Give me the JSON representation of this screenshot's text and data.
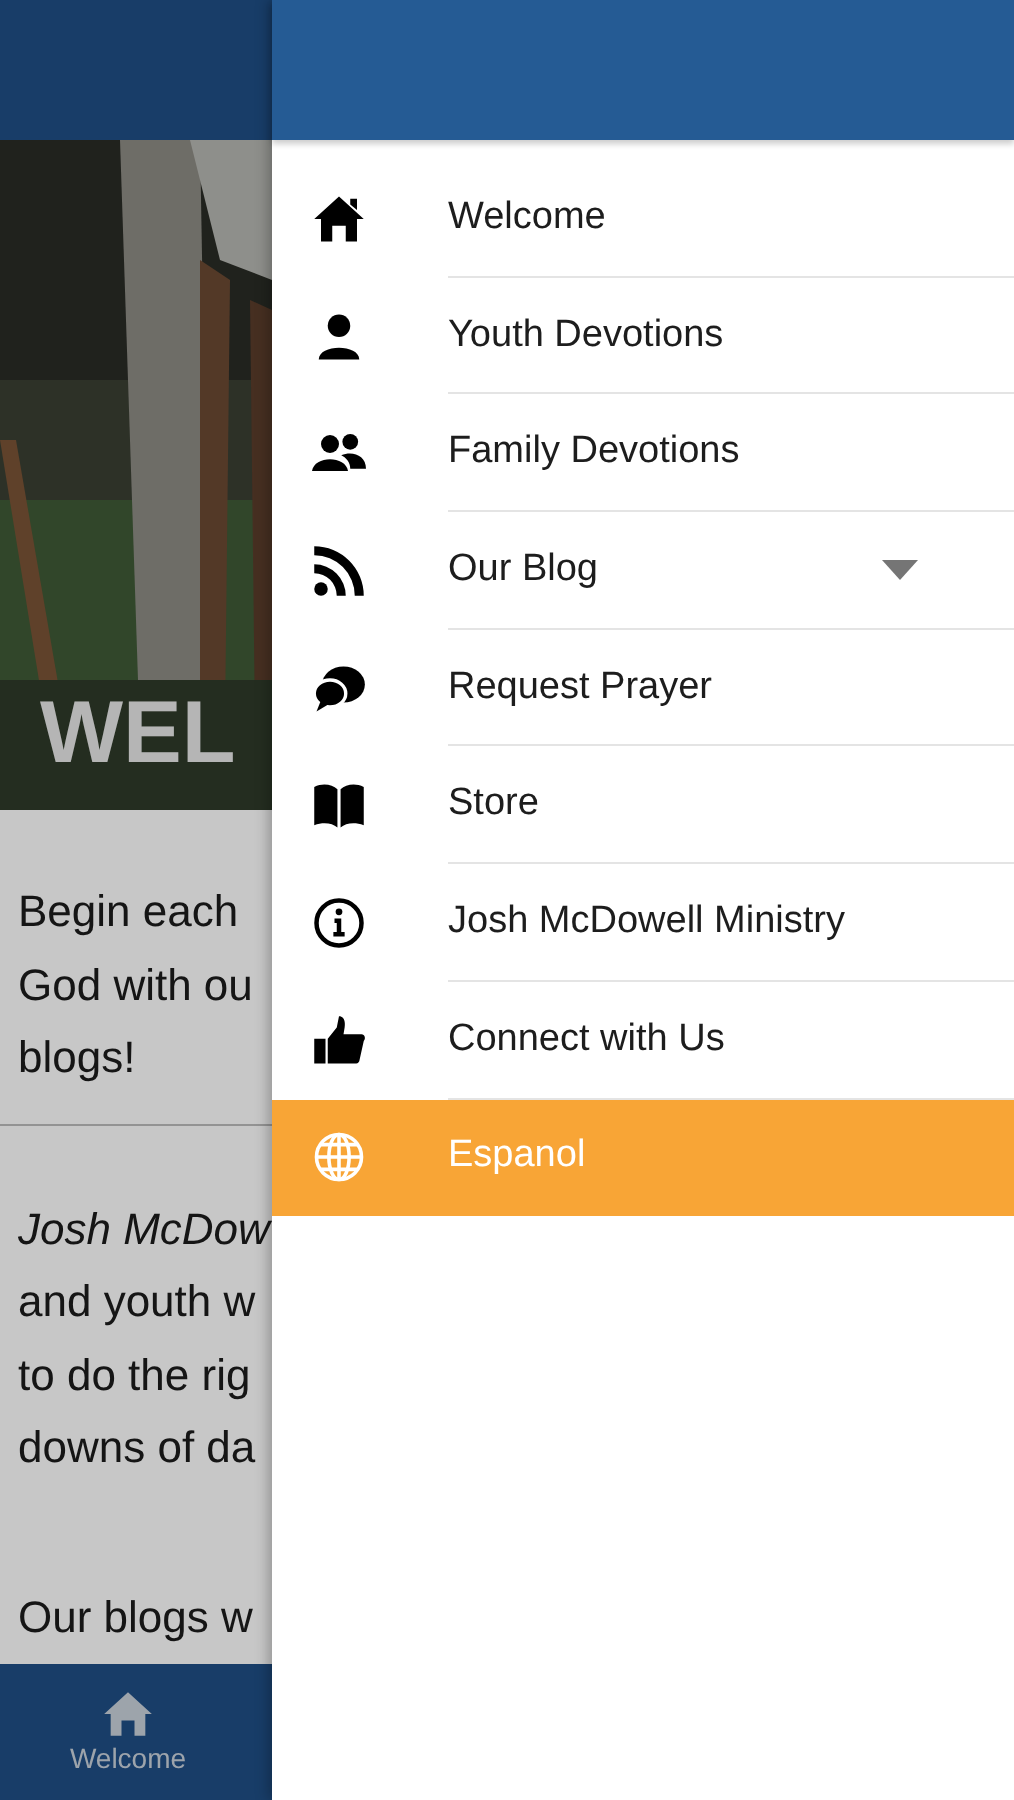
{
  "page": {
    "hero_title": "WEL",
    "paragraphs": [
      {
        "lines": [
          "Begin each",
          "God with ou",
          "blogs!"
        ],
        "italic_first": false
      },
      {
        "lines": [
          "Josh McDow",
          "and youth w",
          "to do the rig",
          "downs of da"
        ],
        "italic_first": true
      },
      {
        "lines": [
          "Our blogs w"
        ],
        "italic_first": false
      }
    ],
    "bottom_nav": [
      {
        "label": "Welcome",
        "selected": true
      }
    ]
  },
  "drawer": {
    "items": [
      {
        "label": "Welcome",
        "selected": false,
        "has_submenu": false
      },
      {
        "label": "Youth Devotions",
        "selected": false,
        "has_submenu": false
      },
      {
        "label": "Family Devotions",
        "selected": false,
        "has_submenu": false
      },
      {
        "label": "Our Blog",
        "selected": false,
        "has_submenu": true
      },
      {
        "label": "Request Prayer",
        "selected": false,
        "has_submenu": false
      },
      {
        "label": "Store",
        "selected": false,
        "has_submenu": false
      },
      {
        "label": "Josh McDowell Ministry",
        "selected": false,
        "has_submenu": false
      },
      {
        "label": "Connect with Us",
        "selected": false,
        "has_submenu": false
      },
      {
        "label": "Espanol",
        "selected": true,
        "has_submenu": false
      }
    ]
  }
}
